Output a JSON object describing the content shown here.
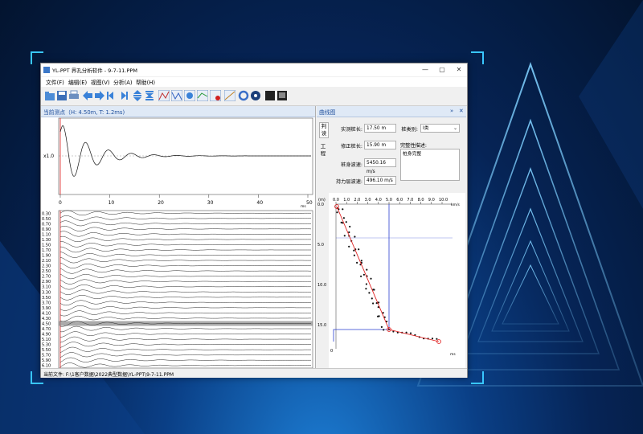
{
  "window": {
    "title": "YL-PPT 界孔分析软件 - 9-7-11.PPM",
    "minimize": "—",
    "maximize": "▢",
    "close": "✕"
  },
  "menu": [
    "文件(F)",
    "编辑(E)",
    "视图(V)",
    "分析(A)",
    "帮助(H)"
  ],
  "left_panel": {
    "header": "当前测点（H: 4.50m, T: 1.2ms)",
    "wave_ylabel": "x1.0",
    "wave_xticks": [
      "0",
      "10",
      "20",
      "30",
      "40",
      "50"
    ],
    "wave_xunit": "ms",
    "depth_labels": [
      "0.30",
      "0.50",
      "0.70",
      "0.90",
      "1.10",
      "1.30",
      "1.50",
      "1.70",
      "1.90",
      "2.10",
      "2.30",
      "2.50",
      "2.70",
      "2.90",
      "3.10",
      "3.30",
      "3.50",
      "3.70",
      "3.90",
      "4.10",
      "4.30",
      "4.50",
      "4.70",
      "4.90",
      "5.10",
      "5.30",
      "5.50",
      "5.70",
      "5.90",
      "6.10"
    ]
  },
  "right_panel": {
    "header": "曲线图",
    "header_icons": [
      "»",
      "✕"
    ],
    "tabs": [
      "判读",
      "工程"
    ],
    "fields": [
      {
        "label": "实测桩长:",
        "value": "17.50 m"
      },
      {
        "label": "修正桩长:",
        "value": "15.90 m"
      },
      {
        "label": "桩身波速:",
        "value": "5450.16 m/s"
      },
      {
        "label": "持力层波速:",
        "value": "496.10 m/s"
      }
    ],
    "pile_type_label": "桩类别:",
    "pile_type_value": "I类",
    "integrity_label": "完整性描述:",
    "integrity_value": "桩身完整",
    "plot_xticks": [
      "0.0",
      "1.0",
      "2.0",
      "3.0",
      "4.0",
      "5.0",
      "6.0",
      "7.0",
      "8.0",
      "9.0",
      "10.0"
    ],
    "plot_xunit": "km/s",
    "plot_yunit": "(m)",
    "plot_yticks": [
      "0.0",
      "5.0",
      "10.0",
      "15.0"
    ],
    "plot_bottom_tick": "0",
    "plot_bottom_unit": "ms"
  },
  "status_bar": "当前文件: F:\\1客户数据\\2022典型数据\\YL-PPT\\9-7-11.PPM",
  "colors": {
    "accent": "#39c6ff",
    "panel_header": "#1f4f9c",
    "red_line": "#e02020",
    "blue_line": "#2a3fd0"
  }
}
